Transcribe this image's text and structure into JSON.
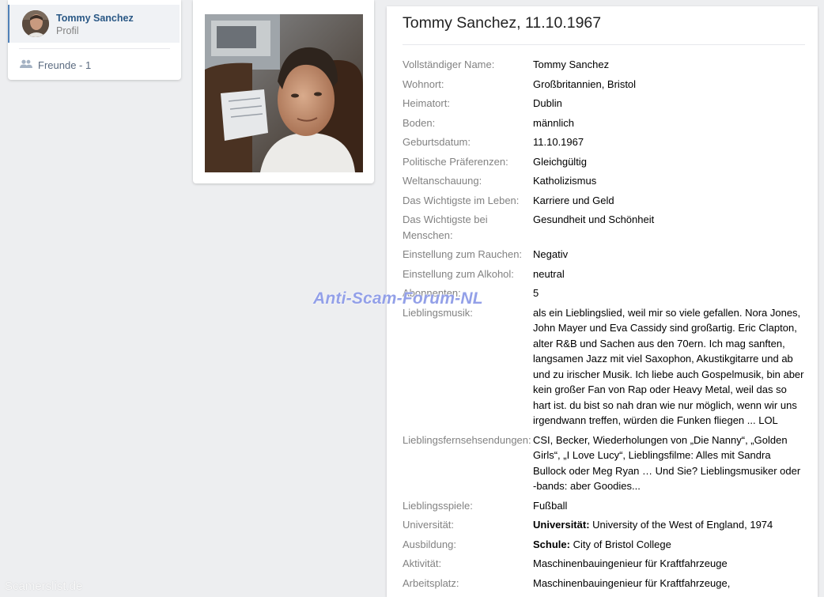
{
  "sidebar": {
    "profile_name": "Tommy Sanchez",
    "profile_sub": "Profil",
    "friends_label": "Freunde - 1"
  },
  "profile": {
    "title": "Tommy Sanchez, 11.10.1967",
    "fields": [
      {
        "label": "Vollständiger Name:",
        "value": "Tommy Sanchez"
      },
      {
        "label": "Wohnort:",
        "value": "Großbritannien, Bristol"
      },
      {
        "label": "Heimatort:",
        "value": "Dublin"
      },
      {
        "label": "Boden:",
        "value": "männlich"
      },
      {
        "label": "Geburtsdatum:",
        "value": "11.10.1967"
      },
      {
        "label": "Politische Präferenzen:",
        "value": "Gleichgültig"
      },
      {
        "label": "Weltanschauung:",
        "value": "Katholizismus"
      },
      {
        "label": "Das Wichtigste im Leben:",
        "value": "Karriere und Geld"
      },
      {
        "label": "Das Wichtigste bei Menschen:",
        "value": "Gesundheit und Schönheit"
      },
      {
        "label": "Einstellung zum Rauchen:",
        "value": "Negativ"
      },
      {
        "label": "Einstellung zum Alkohol:",
        "value": "neutral"
      },
      {
        "label": "Abonnenten:",
        "value": "5"
      },
      {
        "label": "Lieblingsmusik:",
        "value": "als ein Lieblingslied, weil mir so viele gefallen. Nora Jones, John Mayer und Eva Cassidy sind großartig. Eric Clapton, alter R&B und Sachen aus den 70ern. Ich mag sanften, langsamen Jazz mit viel Saxophon, Akustikgitarre und ab und zu irischer Musik. Ich liebe auch Gospelmusik, bin aber kein großer Fan von Rap oder Heavy Metal, weil das so hart ist. du bist so nah dran wie nur möglich, wenn wir uns irgendwann treffen, würden die Funken fliegen ... LOL"
      },
      {
        "label": "Lieblingsfernsehsendungen:",
        "value": "CSI, Becker, Wiederholungen von „Die Nanny“, „Golden Girls“, „I Love Lucy“, Lieblingsfilme: Alles mit Sandra Bullock oder Meg Ryan … Und Sie? Lieblingsmusiker oder -bands: aber Goodies..."
      },
      {
        "label": "Lieblingsspiele:",
        "value": "Fußball"
      },
      {
        "label": "Universität:",
        "value_prefix": "Universität:",
        "value": " University of the West of England, 1974"
      },
      {
        "label": "Ausbildung:",
        "value_prefix": "Schule:",
        "value": " City of Bristol College"
      },
      {
        "label": "Aktivität:",
        "value": "Maschinenbauingenieur für Kraftfahrzeuge"
      },
      {
        "label": "Arbeitsplatz:",
        "value": "Maschinenbauingenieur für Kraftfahrzeuge,"
      }
    ]
  },
  "watermark": "Anti-Scam-Forum-NL",
  "footer_watermark": "Scamerslist.de"
}
